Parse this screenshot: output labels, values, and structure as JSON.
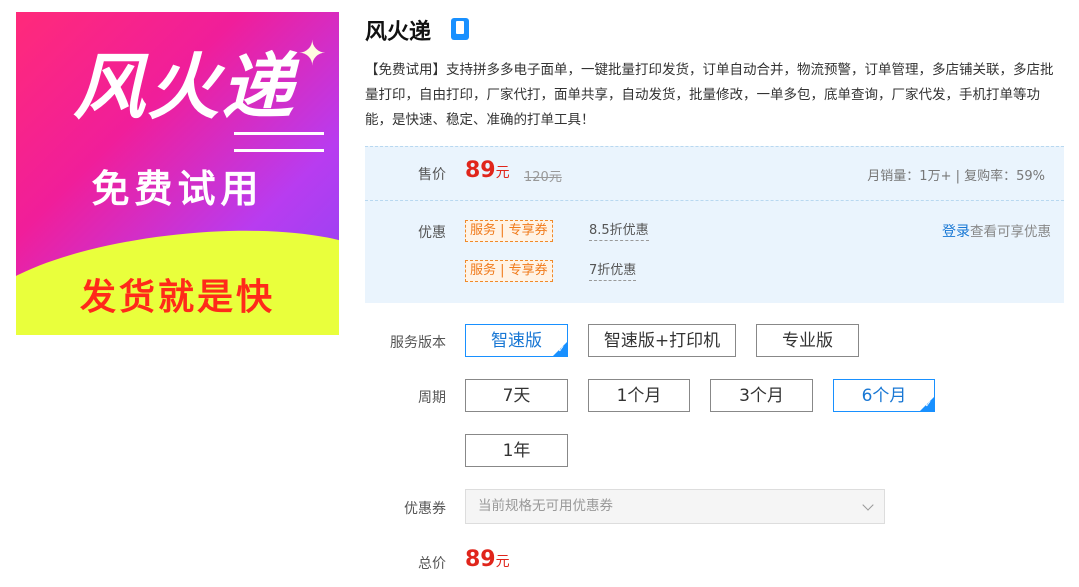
{
  "banner": {
    "logo": "风火递",
    "slogan": "免费试用",
    "tagline": "发货就是快"
  },
  "product": {
    "title": "风火递",
    "description": "【免费试用】支持拼多多电子面单，一键批量打印发货，订单自动合并，物流预警，订单管理，多店铺关联，多店批量打印，自由打印，厂家代打，面单共享，自动发货，批量修改，一单多包，底单查询，厂家代发，手机打单等功能，是快速、稳定、准确的打单工具！"
  },
  "price": {
    "label": "售价",
    "value": "89",
    "unit": "元",
    "original": "120元",
    "sales": "月销量：1万+ | 复购率：59%"
  },
  "discount": {
    "label": "优惠",
    "coupons": [
      {
        "tag": "服务 | 专享券",
        "text": "8.5折优惠"
      },
      {
        "tag": "服务 | 专享券",
        "text": "7折优惠"
      }
    ],
    "login_link": "登录",
    "login_hint": "查看可享优惠"
  },
  "service_version": {
    "label": "服务版本",
    "options": [
      "智速版",
      "智速版+打印机",
      "专业版"
    ],
    "selected": "智速版"
  },
  "period": {
    "label": "周期",
    "options": [
      "7天",
      "1个月",
      "3个月",
      "6个月",
      "1年"
    ],
    "selected": "6个月"
  },
  "coupon_select": {
    "label": "优惠券",
    "placeholder": "当前规格无可用优惠券"
  },
  "total": {
    "label": "总价",
    "value": "89",
    "unit": "元"
  },
  "colors": {
    "accent_blue": "#1890ff",
    "price_red": "#e0251b",
    "coupon_orange": "#f07a1a",
    "panel_bg": "#eaf4fd"
  }
}
